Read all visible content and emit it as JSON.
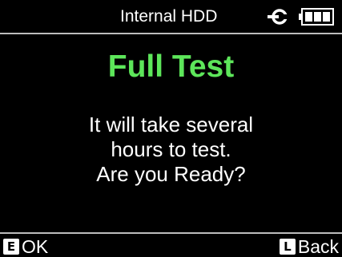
{
  "header": {
    "title": "Internal HDD",
    "status_icons": [
      "ac-power-plug-icon",
      "battery-full-icon"
    ]
  },
  "dialog": {
    "title": "Full Test",
    "title_color": "#5de65a",
    "message_lines": [
      "It will take several",
      "hours to test.",
      "Are you Ready?"
    ]
  },
  "softkeys": {
    "left": {
      "key": "E",
      "label": "OK"
    },
    "right": {
      "key": "L",
      "label": "Back"
    }
  }
}
